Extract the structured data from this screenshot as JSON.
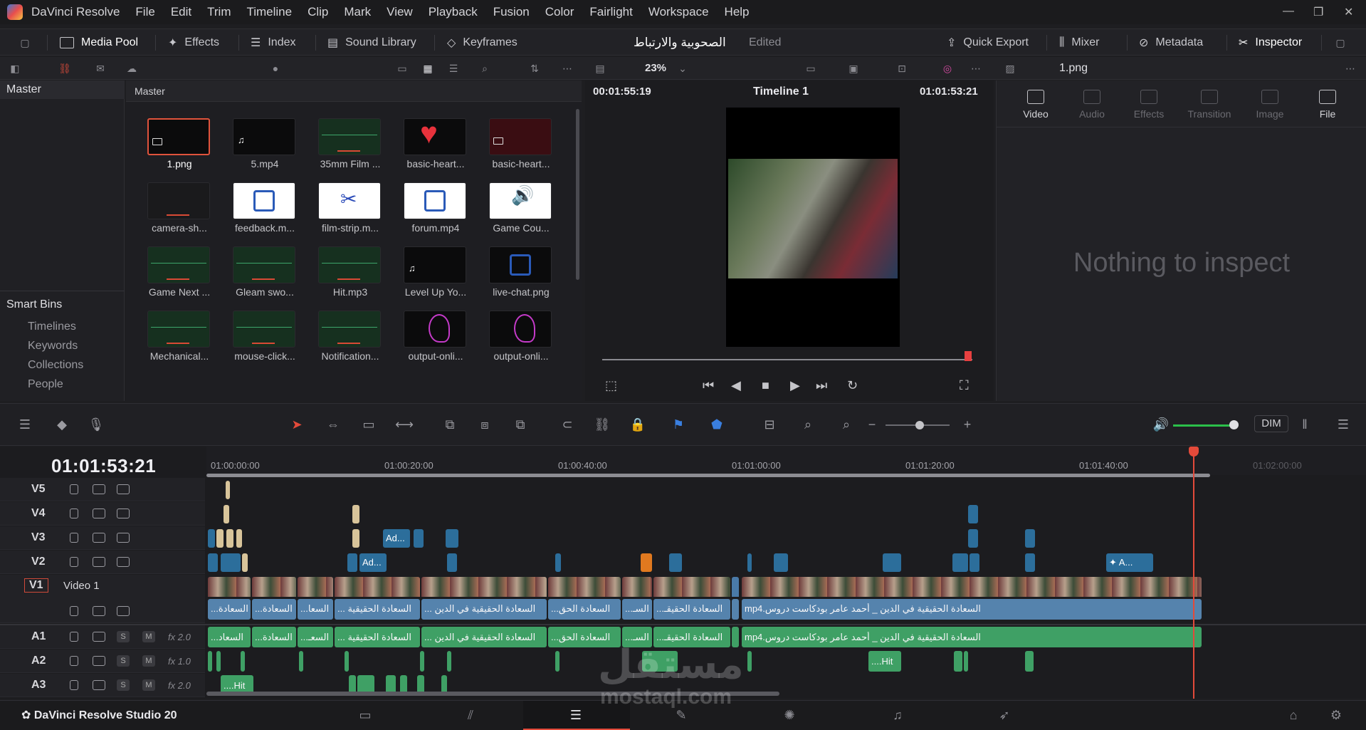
{
  "menu": {
    "app": "DaVinci Resolve",
    "items": [
      "File",
      "Edit",
      "Trim",
      "Timeline",
      "Clip",
      "Mark",
      "View",
      "Playback",
      "Fusion",
      "Color",
      "Fairlight",
      "Workspace",
      "Help"
    ]
  },
  "toolbar": {
    "media_pool": "Media Pool",
    "effects": "Effects",
    "index": "Index",
    "sound_library": "Sound Library",
    "keyframes": "Keyframes",
    "project_title": "الصحوبية والارتباط",
    "project_status": "Edited",
    "quick_export": "Quick Export",
    "mixer": "Mixer",
    "metadata": "Metadata",
    "inspector": "Inspector"
  },
  "subbar": {
    "zoom": "23%",
    "selected_file": "1.png"
  },
  "bins": {
    "master": "Master",
    "smart_bins": "Smart Bins",
    "smart_items": [
      "Timelines",
      "Keywords",
      "Collections",
      "People"
    ]
  },
  "pool": {
    "title": "Master",
    "clips": [
      {
        "label": "1.png"
      },
      {
        "label": "5.mp4"
      },
      {
        "label": "35mm Film ..."
      },
      {
        "label": "basic-heart..."
      },
      {
        "label": "basic-heart..."
      },
      {
        "label": "camera-sh..."
      },
      {
        "label": "feedback.m..."
      },
      {
        "label": "film-strip.m..."
      },
      {
        "label": "forum.mp4"
      },
      {
        "label": "Game Cou..."
      },
      {
        "label": "Game Next ..."
      },
      {
        "label": "Gleam swo..."
      },
      {
        "label": "Hit.mp3"
      },
      {
        "label": "Level Up Yo..."
      },
      {
        "label": "live-chat.png"
      },
      {
        "label": "Mechanical..."
      },
      {
        "label": "mouse-click..."
      },
      {
        "label": "Notification..."
      },
      {
        "label": "output-onli..."
      },
      {
        "label": "output-onli..."
      }
    ]
  },
  "viewer": {
    "tc_left": "00:01:55:19",
    "timeline_name": "Timeline 1",
    "tc_right": "01:01:53:21"
  },
  "inspector": {
    "tabs": [
      "Video",
      "Audio",
      "Effects",
      "Transition",
      "Image",
      "File"
    ],
    "empty_text": "Nothing to inspect"
  },
  "timeline_tools": {
    "dim": "DIM"
  },
  "timeline": {
    "timecode": "01:01:53:21",
    "ruler": [
      "01:00:00:00",
      "01:00:20:00",
      "01:00:40:00",
      "01:01:00:00",
      "01:01:20:00",
      "01:01:40:00",
      "01:02:00:00"
    ],
    "tracks": {
      "v5": "V5",
      "v4": "V4",
      "v3": "V3",
      "v2": "V2",
      "v1": "V1",
      "v1_name": "Video 1",
      "a1": "A1",
      "a2": "A2",
      "a3": "A3",
      "a1_level": "2.0",
      "a2_level": "1.0",
      "a3_level": "2.0",
      "fx": "fx",
      "s": "S",
      "m": "M"
    },
    "v3_clip": "Ad...",
    "v2_clip": "Ad...",
    "v2_clip_right": "A...",
    "v1_clips": [
      "السعادة...",
      "السعادة...",
      "السعا...",
      "السعادة الحقيقية ...",
      "السعادة الحقيقية في الدين ...",
      "السعادة الحق...",
      "السـ...",
      "السعادة الحقيقـ...",
      "السعادة الحقيقية في الدين _ أحمد عامر بودكاست دروس.mp4"
    ],
    "a1_clips": [
      "السعاد...",
      "السعادة...",
      "السعـ...",
      "السعادة الحقيقية ...",
      "السعادة الحقيقية في الدين ...",
      "السعادة الحق...",
      "السـ...",
      "السعادة الحقيقـ...",
      "السعادة الحقيقية في الدين _ أحمد عامر بودكاست دروس.mp4"
    ],
    "a2_clip": "Hit....",
    "a3_clip": "Hit...."
  },
  "pagebar": {
    "brand": "DaVinci Resolve Studio 20"
  },
  "watermark": {
    "line1": "مستقل",
    "line2": "mostaql.com"
  }
}
